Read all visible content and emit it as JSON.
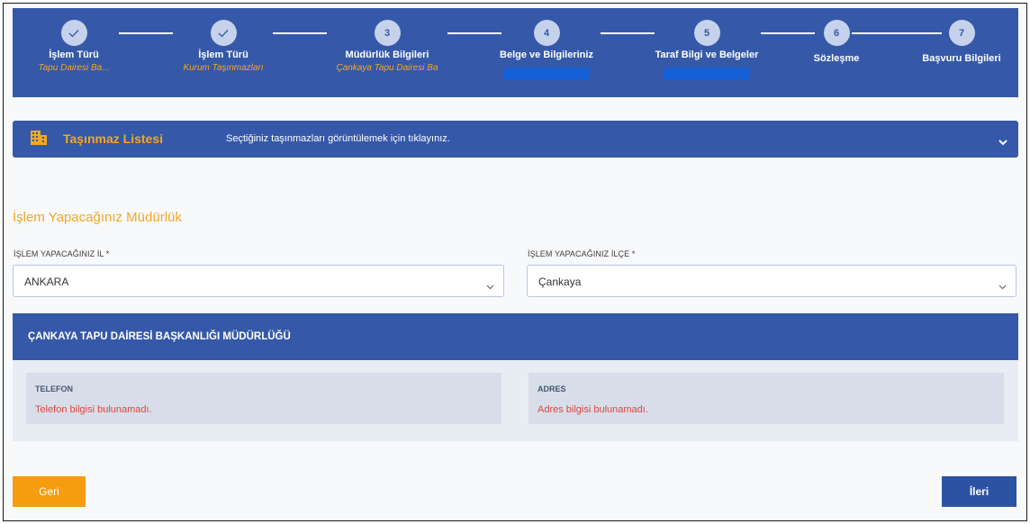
{
  "steps": [
    {
      "number": "1",
      "done": true,
      "title": "İşlem Türü",
      "sub": "Tapu Dairesi Ba..."
    },
    {
      "number": "2",
      "done": true,
      "title": "İşlem Türü",
      "sub": "Kurum Taşınmazları"
    },
    {
      "number": "3",
      "done": false,
      "title": "Müdürlük Bilgileri",
      "sub": "Çankaya Tapu Dairesi Ba"
    },
    {
      "number": "4",
      "done": false,
      "title": "Belge ve Bilgileriniz",
      "sub": ""
    },
    {
      "number": "5",
      "done": false,
      "title": "Taraf Bilgi ve Belgeler",
      "sub": ""
    },
    {
      "number": "6",
      "done": false,
      "title": "Sözleşme",
      "sub": ""
    },
    {
      "number": "7",
      "done": false,
      "title": "Başvuru Bilgileri",
      "sub": ""
    }
  ],
  "property_list": {
    "title": "Taşınmaz Listesi",
    "hint": "Seçtiğiniz taşınmazları görüntülemek için tıklayınız.",
    "icon": "building-icon"
  },
  "section_title": "İşlem Yapacağınız Müdürlük",
  "fields": {
    "il": {
      "label": "İŞLEM YAPACAĞINIZ İL  *",
      "value": "ANKARA"
    },
    "ilce": {
      "label": "İŞLEM YAPACAĞINIZ İLÇE  *",
      "value": "Çankaya"
    }
  },
  "office": {
    "name": "ÇANKAYA TAPU DAİRESİ BAŞKANLIĞI MÜDÜRLÜĞÜ",
    "phone_label": "TELEFON",
    "phone_value": "Telefon bilgisi bulunamadı.",
    "address_label": "ADRES",
    "address_value": "Adres bilgisi bulunamadı."
  },
  "buttons": {
    "back": "Geri",
    "next": "İleri"
  },
  "colors": {
    "primary": "#3558a8",
    "accent": "#f5a623",
    "error": "#e0443b",
    "highlight": "#1660d6"
  }
}
